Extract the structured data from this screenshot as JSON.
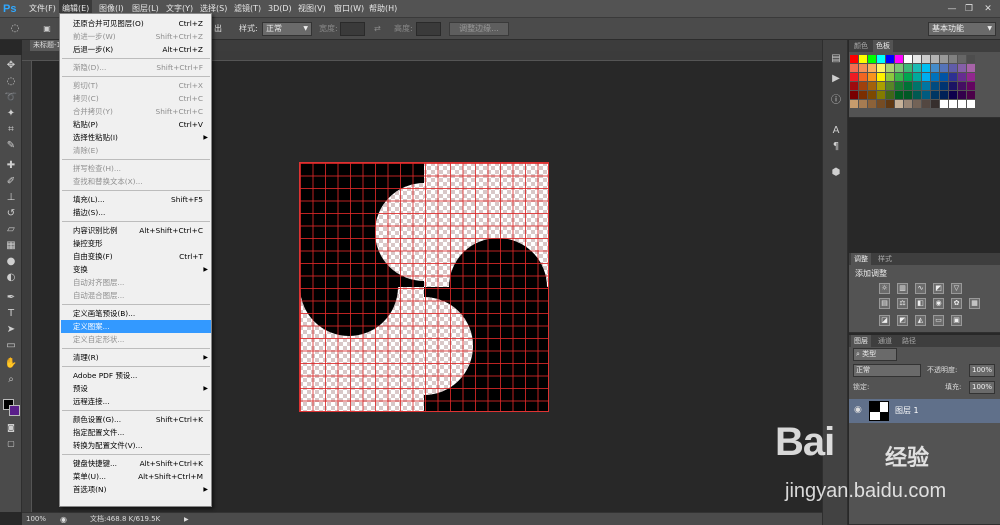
{
  "app": {
    "logo": "Ps"
  },
  "menubar": {
    "items": [
      {
        "label": "文件(F)"
      },
      {
        "label": "编辑(E)"
      },
      {
        "label": "图像(I)"
      },
      {
        "label": "图层(L)"
      },
      {
        "label": "文字(Y)"
      },
      {
        "label": "选择(S)"
      },
      {
        "label": "滤镜(T)"
      },
      {
        "label": "3D(D)"
      },
      {
        "label": "视图(V)"
      },
      {
        "label": "窗口(W)"
      },
      {
        "label": "帮助(H)"
      }
    ],
    "active_index": 1,
    "window_controls": {
      "minimize": "—",
      "restore": "❐",
      "close": "✕"
    }
  },
  "options": {
    "feather_fragment": "出",
    "style_label": "样式:",
    "style_value": "正常",
    "width_label": "宽度:",
    "height_label": "高度:",
    "refine_edge": "调整边缘...",
    "workspace": "基本功能"
  },
  "document": {
    "tab_label": "未标题-1"
  },
  "status": {
    "zoom": "100%",
    "doc_info": "文档:468.8 K/619.5K"
  },
  "edit_menu": [
    {
      "label": "还原合并可见图层(O)",
      "shortcut": "Ctrl+Z",
      "disabled": false
    },
    {
      "label": "前进一步(W)",
      "shortcut": "Shift+Ctrl+Z",
      "disabled": true
    },
    {
      "label": "后退一步(K)",
      "shortcut": "Alt+Ctrl+Z",
      "disabled": false
    },
    {
      "sep": true
    },
    {
      "label": "渐隐(D)...",
      "shortcut": "Shift+Ctrl+F",
      "disabled": true
    },
    {
      "sep": true
    },
    {
      "label": "剪切(T)",
      "shortcut": "Ctrl+X",
      "disabled": true
    },
    {
      "label": "拷贝(C)",
      "shortcut": "Ctrl+C",
      "disabled": true
    },
    {
      "label": "合并拷贝(Y)",
      "shortcut": "Shift+Ctrl+C",
      "disabled": true
    },
    {
      "label": "粘贴(P)",
      "shortcut": "Ctrl+V",
      "disabled": false
    },
    {
      "label": "选择性粘贴(I)",
      "shortcut": "",
      "disabled": false,
      "submenu": true
    },
    {
      "label": "清除(E)",
      "shortcut": "",
      "disabled": true
    },
    {
      "sep": true
    },
    {
      "label": "拼写检查(H)...",
      "shortcut": "",
      "disabled": true
    },
    {
      "label": "查找和替换文本(X)...",
      "shortcut": "",
      "disabled": true
    },
    {
      "sep": true
    },
    {
      "label": "填充(L)...",
      "shortcut": "Shift+F5",
      "disabled": false
    },
    {
      "label": "描边(S)...",
      "shortcut": "",
      "disabled": false
    },
    {
      "sep": true
    },
    {
      "label": "内容识别比例",
      "shortcut": "Alt+Shift+Ctrl+C",
      "disabled": false
    },
    {
      "label": "操控变形",
      "shortcut": "",
      "disabled": false
    },
    {
      "label": "自由变换(F)",
      "shortcut": "Ctrl+T",
      "disabled": false
    },
    {
      "label": "变换",
      "shortcut": "",
      "disabled": false,
      "submenu": true
    },
    {
      "label": "自动对齐图层...",
      "shortcut": "",
      "disabled": true
    },
    {
      "label": "自动混合图层...",
      "shortcut": "",
      "disabled": true
    },
    {
      "sep": true
    },
    {
      "label": "定义画笔预设(B)...",
      "shortcut": "",
      "disabled": false
    },
    {
      "label": "定义图案...",
      "shortcut": "",
      "disabled": false,
      "highlighted": true
    },
    {
      "label": "定义自定形状...",
      "shortcut": "",
      "disabled": true
    },
    {
      "sep": true
    },
    {
      "label": "清理(R)",
      "shortcut": "",
      "disabled": false,
      "submenu": true
    },
    {
      "sep": true
    },
    {
      "label": "Adobe PDF 预设...",
      "shortcut": "",
      "disabled": false
    },
    {
      "label": "预设",
      "shortcut": "",
      "disabled": false,
      "submenu": true
    },
    {
      "label": "远程连接...",
      "shortcut": "",
      "disabled": false
    },
    {
      "sep": true
    },
    {
      "label": "颜色设置(G)...",
      "shortcut": "Shift+Ctrl+K",
      "disabled": false
    },
    {
      "label": "指定配置文件...",
      "shortcut": "",
      "disabled": false
    },
    {
      "label": "转换为配置文件(V)...",
      "shortcut": "",
      "disabled": false
    },
    {
      "sep": true
    },
    {
      "label": "键盘快捷键...",
      "shortcut": "Alt+Shift+Ctrl+K",
      "disabled": false
    },
    {
      "label": "菜单(U)...",
      "shortcut": "Alt+Shift+Ctrl+M",
      "disabled": false
    },
    {
      "label": "首选项(N)",
      "shortcut": "",
      "disabled": false,
      "submenu": true
    }
  ],
  "panels": {
    "swatches": {
      "tabs": [
        "颜色",
        "色板"
      ],
      "active_tab": 1
    },
    "adjustments": {
      "tabs": [
        "调整",
        "样式"
      ],
      "title": "添加调整"
    },
    "layers": {
      "tabs": [
        "图层",
        "通道",
        "路径"
      ],
      "filter": "类型",
      "blend_mode": "正常",
      "opacity_label": "不透明度:",
      "opacity_value": "100%",
      "lock_label": "锁定:",
      "fill_label": "填充:",
      "fill_value": "100%",
      "layer_name": "图层 1"
    }
  },
  "watermark": {
    "logo": "Bai",
    "logo_suffix": "经验",
    "url": "jingyan.baidu.com"
  }
}
